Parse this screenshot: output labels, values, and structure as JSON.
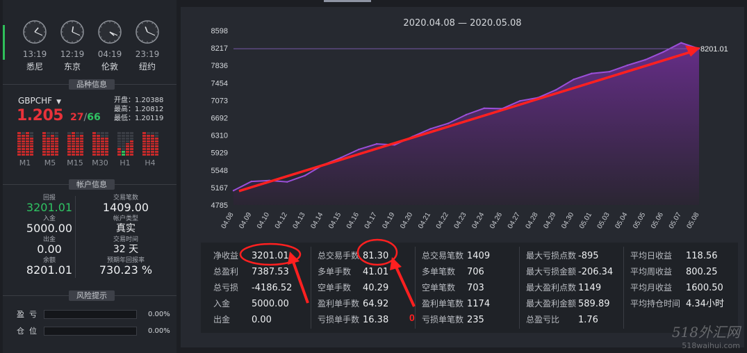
{
  "top_tab_indicator": "",
  "clocks": [
    {
      "time": "13:19",
      "city": "悉尼",
      "h": 13,
      "m": 19
    },
    {
      "time": "12:19",
      "city": "东京",
      "h": 12,
      "m": 19
    },
    {
      "time": "04:19",
      "city": "伦敦",
      "h": 4,
      "m": 19
    },
    {
      "time": "23:19",
      "city": "纽约",
      "h": 23,
      "m": 19
    }
  ],
  "symbol_section": {
    "title": "品种信息",
    "symbol": "GBPCHF",
    "price": "1.205",
    "price_a": "27",
    "price_sep": "/",
    "price_b": "66",
    "open": "开盘：1.20388",
    "high": "最高：1.20812",
    "low": "最低：1.20119",
    "timeframes": [
      {
        "label": "M1"
      },
      {
        "label": "M5"
      },
      {
        "label": "M15"
      },
      {
        "label": "M30"
      },
      {
        "label": "H1"
      },
      {
        "label": "H4"
      }
    ]
  },
  "account_section": {
    "title": "帐户信息",
    "items": [
      {
        "key": "回报",
        "value": "3201.01"
      },
      {
        "key": "交易笔数",
        "value": "1409.00"
      },
      {
        "key": "入金",
        "value": "5000.00"
      },
      {
        "key": "帐户类型",
        "value": "真实"
      },
      {
        "key": "出金",
        "value": "0.00"
      },
      {
        "key": "交易时间",
        "value": "32 天"
      },
      {
        "key": "余额",
        "value": "8201.01"
      },
      {
        "key": "预期年回报率",
        "value": "730.23 %"
      }
    ]
  },
  "risk_section": {
    "title": "风险提示",
    "rows": [
      {
        "label": "盈  亏",
        "pct": "0.00%",
        "level": 0
      },
      {
        "label": "仓  位",
        "pct": "0.00%",
        "level": 0
      }
    ]
  },
  "chart_data": {
    "type": "area",
    "title": "2020.04.08 — 2020.05.08",
    "x": [
      "04.08",
      "04.09",
      "04.10",
      "04.12",
      "04.13",
      "04.14",
      "04.15",
      "04.16",
      "04.17",
      "04.19",
      "04.20",
      "04.21",
      "04.22",
      "04.23",
      "04.24",
      "04.26",
      "04.27",
      "04.28",
      "04.29",
      "04.30",
      "05.01",
      "05.03",
      "05.04",
      "05.05",
      "05.06",
      "05.07",
      "05.08"
    ],
    "y": [
      5100,
      5300,
      5320,
      5290,
      5430,
      5660,
      5820,
      6000,
      6120,
      6100,
      6280,
      6450,
      6570,
      6760,
      6900,
      6890,
      7060,
      7130,
      7300,
      7530,
      7660,
      7700,
      7840,
      7960,
      8130,
      8330,
      8201.01
    ],
    "yticks": [
      4785,
      5167,
      5548,
      5929,
      6310,
      6692,
      7073,
      7454,
      7836,
      8217,
      8598
    ],
    "ylim": [
      4785,
      8598
    ],
    "end_label": "8201.01",
    "ref_line": 8201.01,
    "colors": {
      "line": "#9b4fd8",
      "area_top": "#6a2e8e",
      "area_bottom": "#2b2533",
      "ref": "#7a5aa8"
    }
  },
  "stats": {
    "columns": [
      [
        {
          "k": "净收益",
          "v": "3201.01"
        },
        {
          "k": "总盈利",
          "v": "7387.53"
        },
        {
          "k": "总亏损",
          "v": "-4186.52"
        },
        {
          "k": "入金",
          "v": "5000.00"
        },
        {
          "k": "出金",
          "v": "0.00"
        }
      ],
      [
        {
          "k": "总交易手数",
          "v": "81.30"
        },
        {
          "k": "多单手数",
          "v": "41.01"
        },
        {
          "k": "空单手数",
          "v": "40.29"
        },
        {
          "k": "盈利单手数",
          "v": "64.92"
        },
        {
          "k": "亏损单手数",
          "v": "16.38"
        }
      ],
      [
        {
          "k": "总交易笔数",
          "v": "1409"
        },
        {
          "k": "多单笔数",
          "v": "706"
        },
        {
          "k": "空单笔数",
          "v": "703"
        },
        {
          "k": "盈利单笔数",
          "v": "1174"
        },
        {
          "k": "亏损单笔数",
          "v": "235"
        }
      ],
      [
        {
          "k": "最大亏损点数",
          "v": "-895"
        },
        {
          "k": "最大亏损金额",
          "v": "-206.34"
        },
        {
          "k": "最大盈利点数",
          "v": "1149"
        },
        {
          "k": "最大盈利金额",
          "v": "589.89"
        },
        {
          "k": "总盈亏比",
          "v": "1.76"
        }
      ],
      [
        {
          "k": "平均日收益",
          "v": "118.56"
        },
        {
          "k": "平均周收益",
          "v": "800.25"
        },
        {
          "k": "平均月收益",
          "v": "1600.50"
        },
        {
          "k": "平均持仓时间",
          "v": "4.34小时"
        }
      ]
    ]
  },
  "annotation": {
    "zero_mark": "0",
    "color": "#ff2020"
  },
  "watermark": {
    "line1": "518外汇网",
    "line2": "518waihui.com"
  }
}
